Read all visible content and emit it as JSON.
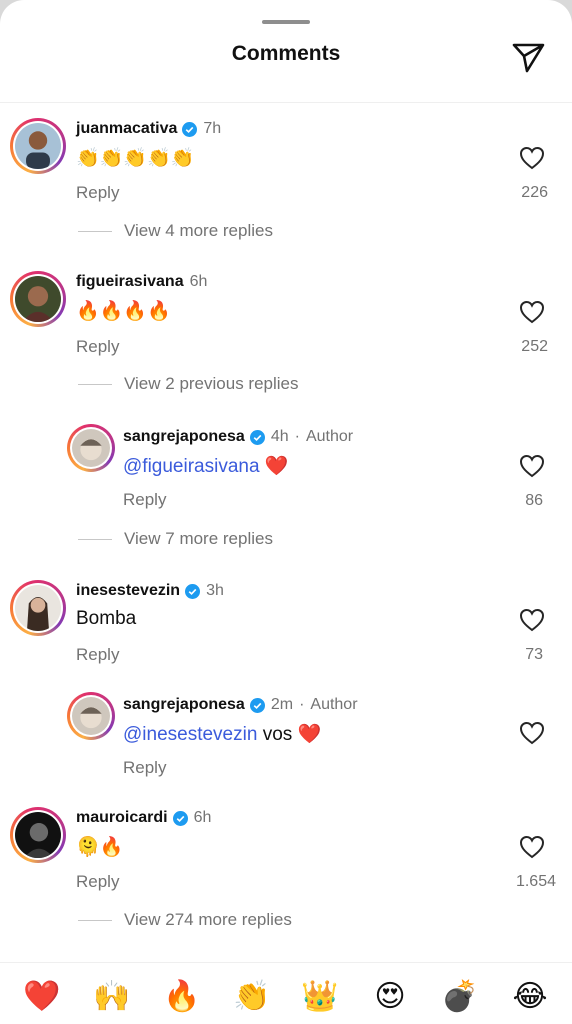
{
  "header": {
    "title": "Comments"
  },
  "comments": [
    {
      "username": "juanmacativa",
      "verified": true,
      "time": "7h",
      "author_tag": "",
      "text": "👏👏👏👏👏",
      "reply": "Reply",
      "likes": "226",
      "view_more": "View 4 more replies"
    },
    {
      "username": "figueirasivana",
      "verified": false,
      "time": "6h",
      "author_tag": "",
      "text": "🔥🔥🔥🔥",
      "reply": "Reply",
      "likes": "252",
      "view_more": "View 2 previous replies"
    },
    {
      "username": "sangrejaponesa",
      "verified": true,
      "time": "4h",
      "author_tag": "Author",
      "mention": "@figueirasivana",
      "text": " ❤️",
      "reply": "Reply",
      "likes": "86",
      "view_more": "View 7 more replies"
    },
    {
      "username": "inesestevezin",
      "verified": true,
      "time": "3h",
      "author_tag": "",
      "text": "Bomba",
      "reply": "Reply",
      "likes": "73"
    },
    {
      "username": "sangrejaponesa",
      "verified": true,
      "time": "2m",
      "author_tag": "Author",
      "mention": "@inesestevezin",
      "text": " vos ❤️",
      "reply": "Reply",
      "likes": ""
    },
    {
      "username": "mauroicardi",
      "verified": true,
      "time": "6h",
      "author_tag": "",
      "text": "🫠🔥",
      "reply": "Reply",
      "likes": "1.654",
      "view_more": "View 274 more replies"
    }
  ],
  "separator": "·",
  "quick_reactions": [
    "❤️",
    "🙌",
    "🔥",
    "👏",
    "👑",
    "😍",
    "💣",
    "😂"
  ],
  "colors": {
    "mention": "#3b5bdb",
    "verified": "#1d9bf0",
    "secondary_text": "#737373"
  }
}
